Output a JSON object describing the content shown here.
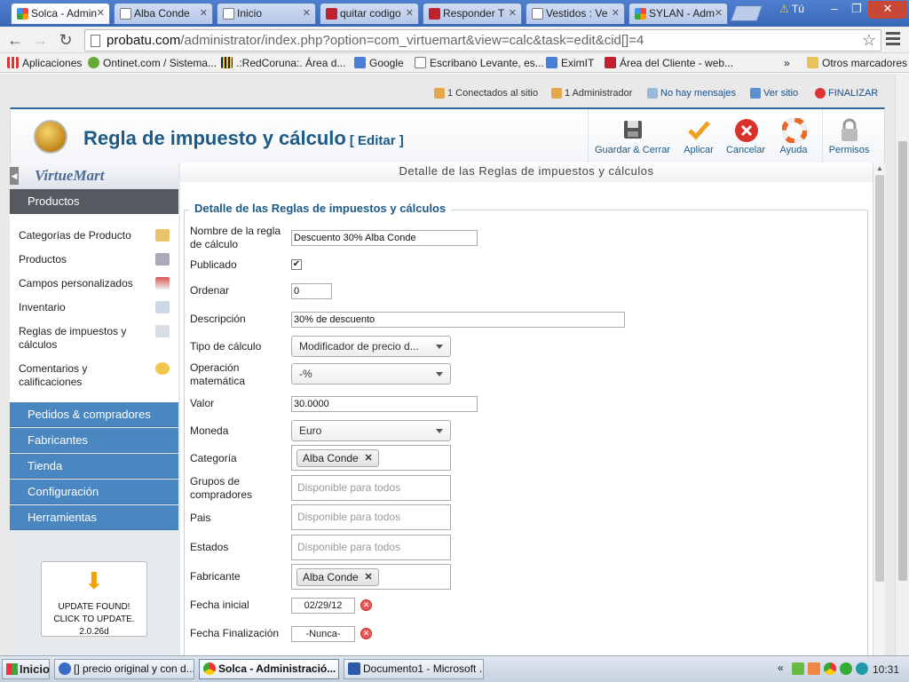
{
  "browser": {
    "tabs": [
      {
        "title": "Solca - Admin",
        "active": true,
        "icon": "joomla-icon"
      },
      {
        "title": "Alba Conde",
        "active": false,
        "icon": "page-icon"
      },
      {
        "title": "Inicio",
        "active": false,
        "icon": "page-icon"
      },
      {
        "title": "quitar codigo",
        "active": false,
        "icon": "w-icon"
      },
      {
        "title": "Responder T",
        "active": false,
        "icon": "w-icon"
      },
      {
        "title": "Vestidos : Ve",
        "active": false,
        "icon": "page-icon"
      },
      {
        "title": "SYLAN - Adm",
        "active": false,
        "icon": "joomla-icon"
      }
    ],
    "profile_label": "Tú",
    "url_host": "probatu.com",
    "url_path": "/administrator/index.php?option=com_virtuemart&view=calc&task=edit&cid[]=4",
    "bookmarks": [
      {
        "label": "Aplicaciones",
        "icon": "apps-icon"
      },
      {
        "label": "Ontinet.com / Sistema...",
        "icon": "ontinet-icon"
      },
      {
        "label": ".:RedCoruna:. Área d...",
        "icon": "redcoruna-icon"
      },
      {
        "label": "Google",
        "icon": "google-icon"
      },
      {
        "label": "Escribano Levante, es...",
        "icon": "page-icon"
      },
      {
        "label": "EximIT",
        "icon": "google-icon"
      },
      {
        "label": "Área del Cliente - web...",
        "icon": "w-icon"
      }
    ],
    "bookmarks_more": "»",
    "other_bookmarks": "Otros marcadores"
  },
  "status": {
    "connected": "1 Conectados al sitio",
    "admin": "1 Administrador",
    "messages": "No hay mensajes",
    "view_site": "Ver sitio",
    "logout": "FINALIZAR"
  },
  "header": {
    "title": "Regla de impuesto y cálculo",
    "subtitle": "[ Editar ]",
    "buttons": {
      "save_close": "Guardar & Cerrar",
      "apply": "Aplicar",
      "cancel": "Cancelar",
      "help": "Ayuda",
      "permissions": "Permisos"
    }
  },
  "sidebar": {
    "logo_text": "VirtueMart",
    "section": "Productos",
    "items": [
      {
        "label": "Categorías de Producto",
        "icon": "folder-icon"
      },
      {
        "label": "Productos",
        "icon": "camera-icon"
      },
      {
        "label": "Campos personalizados",
        "icon": "fields-icon"
      },
      {
        "label": "Inventario",
        "icon": "chart-icon"
      },
      {
        "label": "Reglas de impuestos y cálculos",
        "icon": "calendar-icon"
      },
      {
        "label": "Comentarios y calificaciones",
        "icon": "speech-bubble-icon"
      }
    ],
    "categories": [
      "Pedidos & compradores",
      "Fabricantes",
      "Tienda",
      "Configuración",
      "Herramientas"
    ],
    "update": {
      "line1": "UPDATE FOUND!",
      "line2": "CLICK TO UPDATE.",
      "version": "2.0.26d"
    }
  },
  "content": {
    "top_heading": "Detalle de las Reglas de impuestos y cálculos",
    "legend": "Detalle de las Reglas de impuestos y cálculos",
    "fields": {
      "name_label": "Nombre de la regla de cálculo",
      "name_value": "Descuento 30% Alba Conde",
      "published_label": "Publicado",
      "published_checked": true,
      "order_label": "Ordenar",
      "order_value": "0",
      "description_label": "Descripción",
      "description_value": "30% de descuento",
      "calc_type_label": "Tipo de cálculo",
      "calc_type_value": "Modificador de precio d...",
      "math_op_label": "Operación matemática",
      "math_op_value": "-%",
      "value_label": "Valor",
      "value_value": "30.0000",
      "currency_label": "Moneda",
      "currency_value": "Euro",
      "category_label": "Categoría",
      "category_chip": "Alba Conde",
      "buyer_groups_label": "Grupos de compradores",
      "buyer_groups_placeholder": "Disponible para todos",
      "country_label": "Pais",
      "country_placeholder": "Disponible para todos",
      "states_label": "Estados",
      "states_placeholder": "Disponible para todos",
      "manufacturer_label": "Fabricante",
      "manufacturer_chip": "Alba Conde",
      "start_date_label": "Fecha inicial",
      "start_date_value": "02/29/12",
      "end_date_label": "Fecha Finalización",
      "end_date_value": "-Nunca-"
    }
  },
  "taskbar": {
    "start": "Inicio",
    "tasks": [
      {
        "label": "[] precio original y con d...",
        "active": false
      },
      {
        "label": "Solca - Administració...",
        "active": true
      },
      {
        "label": "Documento1 - Microsoft ...",
        "active": false
      }
    ],
    "tray_expand": "«",
    "clock": "10:31"
  },
  "colors": {
    "accent_blue": "#1d5a86",
    "sidebar_blue": "#4a86c0",
    "cancel_red": "#d9322a",
    "apply_orange": "#f0a020"
  }
}
